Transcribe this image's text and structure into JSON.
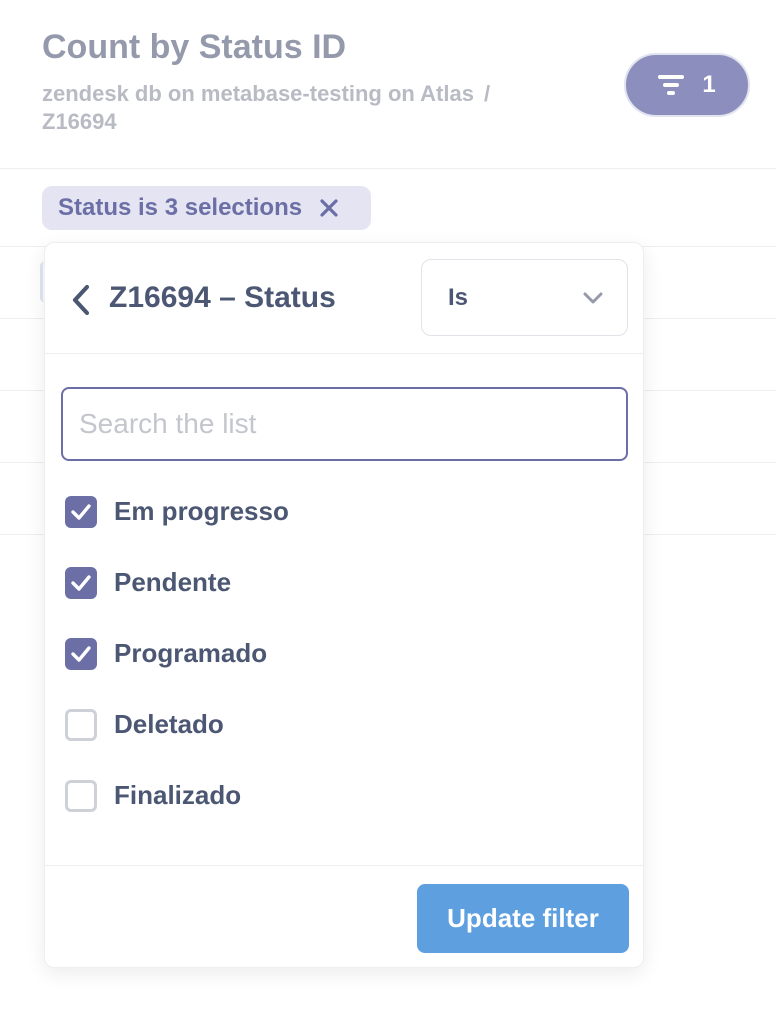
{
  "header": {
    "title": "Count by Status ID",
    "breadcrumb_db": "zendesk db on metabase-testing on Atlas",
    "breadcrumb_sep": "/",
    "breadcrumb_table": "Z16694"
  },
  "filter_toggle": {
    "icon": "filter-icon",
    "count": "1"
  },
  "active_filter_pill": {
    "label": "Status is 3 selections",
    "remove_icon": "close-icon"
  },
  "popover": {
    "title": "Z16694 – Status",
    "operator": {
      "selected": "Is",
      "icon": "chevron-down-icon"
    },
    "search": {
      "placeholder": "Search the list",
      "value": ""
    },
    "options": [
      {
        "label": "Em progresso",
        "checked": true
      },
      {
        "label": "Pendente",
        "checked": true
      },
      {
        "label": "Programado",
        "checked": true
      },
      {
        "label": "Deletado",
        "checked": false
      },
      {
        "label": "Finalizado",
        "checked": false
      }
    ],
    "update_button": "Update filter"
  },
  "colors": {
    "brand": "#6c6fa6",
    "update_button": "#5e9fe0",
    "filter_toggle": "#8c8fbd",
    "pill_background": "#e4e4f2"
  }
}
